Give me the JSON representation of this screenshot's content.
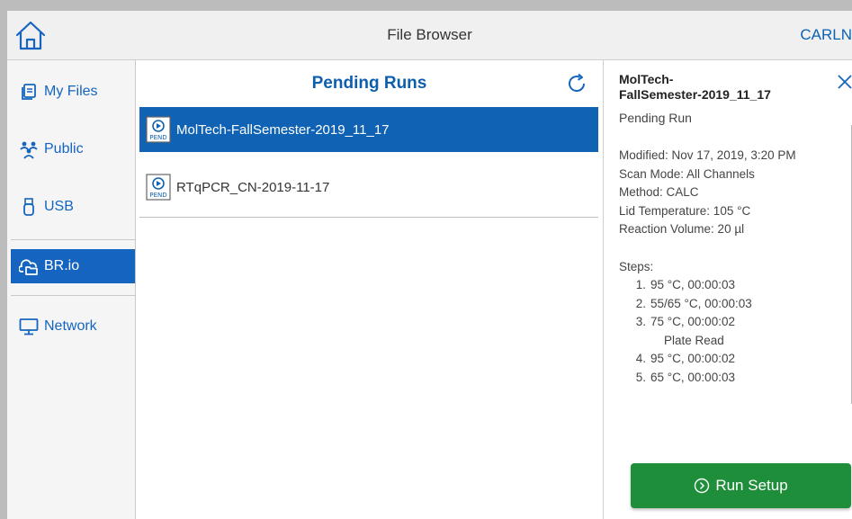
{
  "header": {
    "title": "File Browser",
    "user": "CARLN"
  },
  "sidebar": {
    "items": [
      {
        "label": "My Files",
        "icon": "my-files-icon"
      },
      {
        "label": "Public",
        "icon": "public-users-icon"
      },
      {
        "label": "USB",
        "icon": "usb-icon"
      },
      {
        "label": "BR.io",
        "icon": "cloud-folder-icon"
      },
      {
        "label": "Network",
        "icon": "network-monitor-icon"
      }
    ],
    "active": "BR.io"
  },
  "list": {
    "title": "Pending Runs",
    "rows": [
      {
        "name": "MolTech-FallSemester-2019_11_17",
        "icon": "pend-file-icon",
        "badge": "PEND"
      },
      {
        "name": "RTqPCR_CN-2019-11-17",
        "icon": "pend-file-icon",
        "badge": "PEND"
      }
    ]
  },
  "details": {
    "name": "MolTech-FallSemester-2019_11_17",
    "name_line1": "MolTech-",
    "name_line2": "FallSemester-2019_11_17",
    "subtitle": "Pending Run",
    "modified": "Modified: Nov 17, 2019, 3:20 PM",
    "scan_mode": "Scan Mode: All Channels",
    "method": "Method: CALC",
    "lid_temp": "Lid Temperature: 105 °C",
    "reaction_volume": "Reaction Volume: 20 µl",
    "steps_label": "Steps:",
    "steps": [
      {
        "num": "1.",
        "text": "95 °C, 00:00:03"
      },
      {
        "num": "2.",
        "text": "55/65 °C, 00:00:03"
      },
      {
        "num": "3.",
        "text": "75 °C, 00:00:02",
        "note": "Plate Read"
      },
      {
        "num": "4.",
        "text": "95 °C, 00:00:02"
      },
      {
        "num": "5.",
        "text": "65 °C, 00:00:03"
      }
    ],
    "run_button": "Run Setup"
  },
  "colors": {
    "accent": "#0f62b4",
    "button_green": "#1f8e3a",
    "sidebar_bg": "#f5f5f5",
    "header_bg": "#f0f0f0"
  }
}
